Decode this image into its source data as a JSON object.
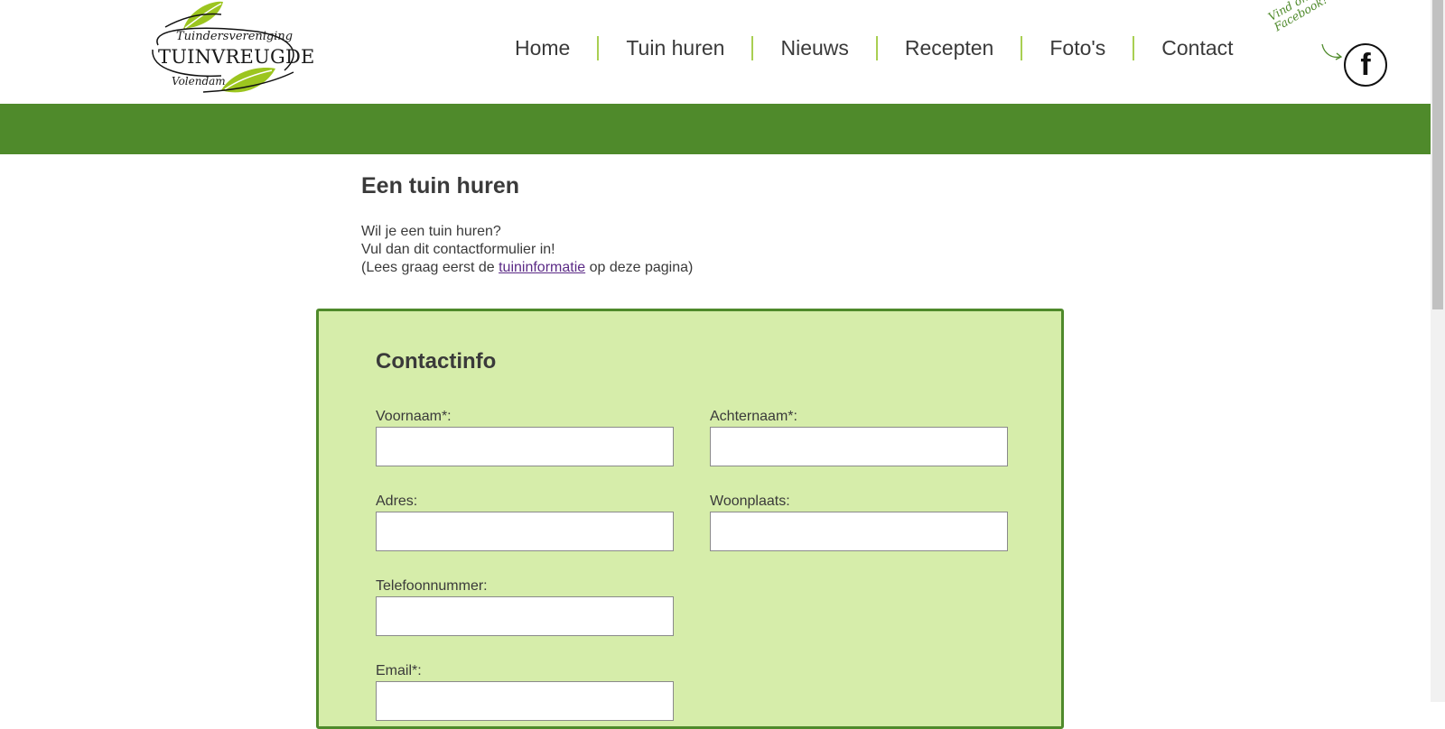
{
  "logo": {
    "line1": "Tuindersvereniging",
    "line2": "TUINVREUGDE",
    "line3": "Volendam"
  },
  "nav": {
    "items": [
      {
        "label": "Home"
      },
      {
        "label": "Tuin huren"
      },
      {
        "label": "Nieuws"
      },
      {
        "label": "Recepten"
      },
      {
        "label": "Foto's"
      },
      {
        "label": "Contact"
      }
    ]
  },
  "facebook": {
    "tagline": "Vind ons ook op Facebook!",
    "icon_letter": "f"
  },
  "colors": {
    "brand_green": "#4f8a2b",
    "light_green": "#d6edaa",
    "accent_lime": "#a9cf52",
    "link_purple": "#5b2a86"
  },
  "main": {
    "title": "Een tuin huren",
    "intro_line1": "Wil je een tuin huren?",
    "intro_line2": "Vul dan dit contactformulier in!",
    "intro_line3_before": "(Lees graag eerst de ",
    "intro_link": "tuininformatie",
    "intro_line3_after": " op deze pagina)"
  },
  "form": {
    "title": "Contactinfo",
    "fields": {
      "voornaam": {
        "label": "Voornaam*:",
        "value": ""
      },
      "achternaam": {
        "label": "Achternaam*:",
        "value": ""
      },
      "adres": {
        "label": "Adres:",
        "value": ""
      },
      "woonplaats": {
        "label": "Woonplaats:",
        "value": ""
      },
      "telefoon": {
        "label": "Telefoonnummer:",
        "value": ""
      },
      "email": {
        "label": "Email*:",
        "value": ""
      }
    }
  }
}
